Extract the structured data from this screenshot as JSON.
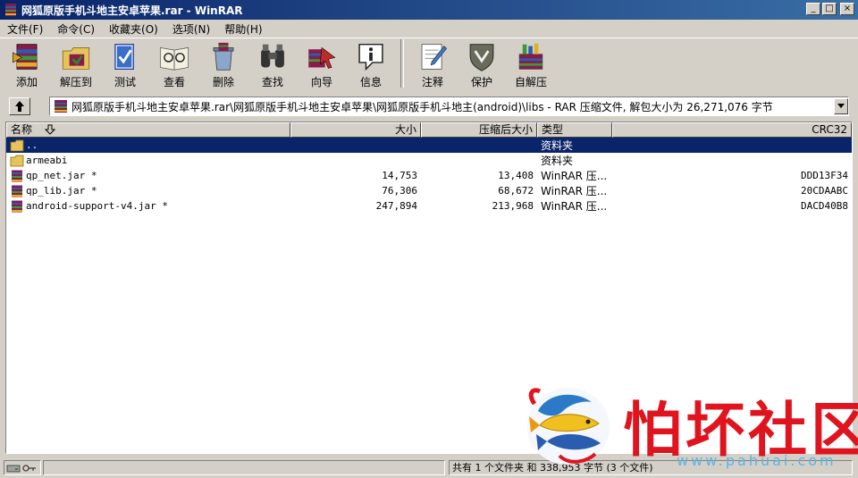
{
  "window": {
    "title": "网狐原版手机斗地主安卓苹果.rar - WinRAR",
    "controls": [
      "_",
      "□",
      "×"
    ]
  },
  "menu": [
    "文件(F)",
    "命令(C)",
    "收藏夹(O)",
    "选项(N)",
    "帮助(H)"
  ],
  "toolbar": [
    {
      "label": "添加",
      "icon": "add-archive-icon"
    },
    {
      "label": "解压到",
      "icon": "extract-to-icon"
    },
    {
      "label": "测试",
      "icon": "test-icon"
    },
    {
      "label": "查看",
      "icon": "view-icon"
    },
    {
      "label": "删除",
      "icon": "delete-icon"
    },
    {
      "label": "查找",
      "icon": "find-icon"
    },
    {
      "label": "向导",
      "icon": "wizard-icon"
    },
    {
      "label": "信息",
      "icon": "info-icon"
    },
    {
      "label": "注释",
      "icon": "comment-icon"
    },
    {
      "label": "保护",
      "icon": "protect-icon"
    },
    {
      "label": "自解压",
      "icon": "sfx-icon"
    }
  ],
  "path": "网狐原版手机斗地主安卓苹果.rar\\网狐原版手机斗地主安卓苹果\\网狐原版手机斗地主(android)\\libs - RAR 压缩文件, 解包大小为 26,271,076 字节",
  "columns": {
    "name": "名称",
    "size": "大小",
    "packed": "压缩后大小",
    "type": "类型",
    "crc": "CRC32"
  },
  "files": [
    {
      "name": "..",
      "size": "",
      "packed": "",
      "type": "资料夹",
      "crc": "",
      "kind": "folder"
    },
    {
      "name": "armeabi",
      "size": "",
      "packed": "",
      "type": "资料夹",
      "crc": "",
      "kind": "folder"
    },
    {
      "name": "qp_net.jar *",
      "size": "14,753",
      "packed": "13,408",
      "type": "WinRAR 压...",
      "crc": "DDD13F34",
      "kind": "archive"
    },
    {
      "name": "qp_lib.jar *",
      "size": "76,306",
      "packed": "68,672",
      "type": "WinRAR 压...",
      "crc": "20CDAABC",
      "kind": "archive"
    },
    {
      "name": "android-support-v4.jar *",
      "size": "247,894",
      "packed": "213,968",
      "type": "WinRAR 压...",
      "crc": "DACD40B8",
      "kind": "archive"
    }
  ],
  "status": {
    "summary": "共有 1 个文件夹 和 338,953 字节 (3 个文件)"
  },
  "watermark": {
    "text": "怕坏社区",
    "url": "www.pahuai.com"
  }
}
